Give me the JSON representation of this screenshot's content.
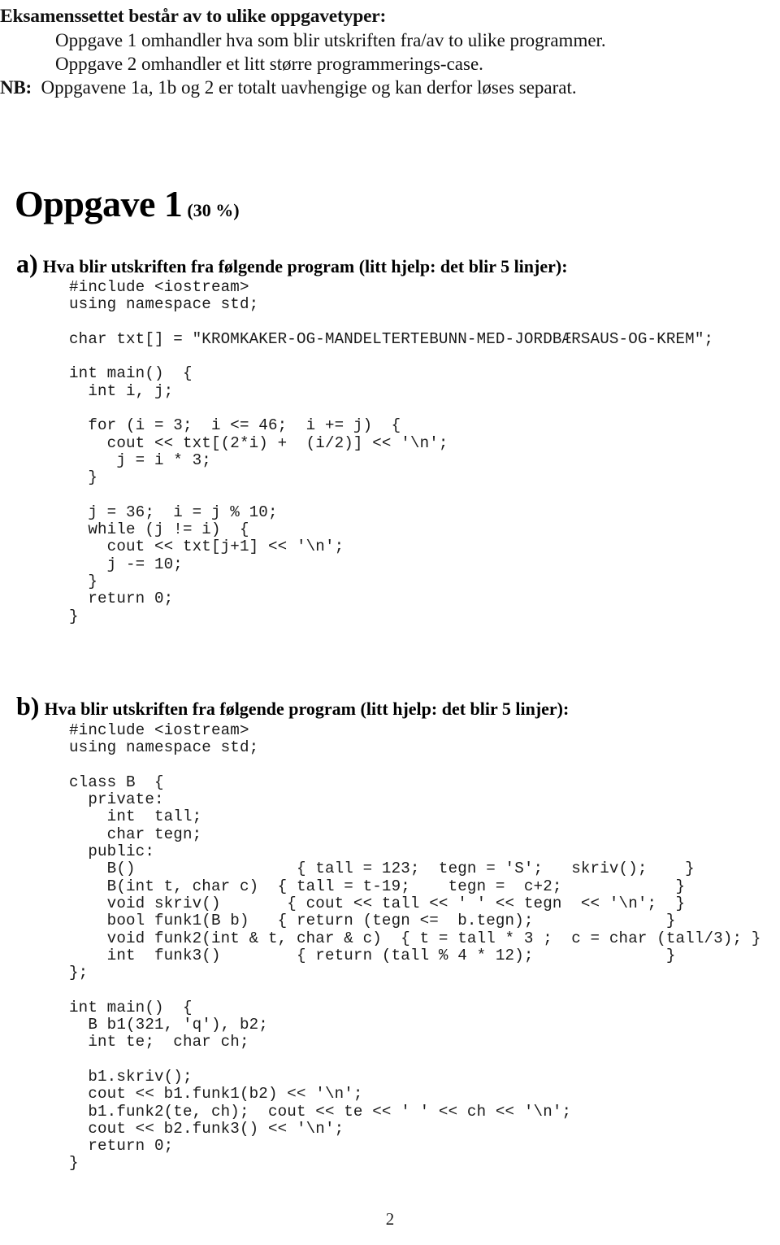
{
  "intro": {
    "heading": "Eksamenssettet består av to ulike oppgavetyper:",
    "line1": "Oppgave 1 omhandler hva som blir utskriften fra/av to ulike programmer.",
    "line2": "Oppgave 2 omhandler et litt større programmerings-case.",
    "nb_label": "NB:",
    "nb_text": "  Oppgavene 1a, 1b og 2 er totalt uavhengige og kan derfor løses separat."
  },
  "oppgave": {
    "title": "Oppgave 1",
    "weight": "(30 %)"
  },
  "questions": {
    "a": {
      "letter": "a)",
      "text": "Hva blir utskriften fra følgende program (litt hjelp: det blir 5 linjer):",
      "code": "#include <iostream>\nusing namespace std;\n\nchar txt[] = \"KROMKAKER-OG-MANDELTERTEBUNN-MED-JORDBÆRSAUS-OG-KREM\";\n\nint main()  {\n  int i, j;\n\n  for (i = 3;  i <= 46;  i += j)  {\n    cout << txt[(2*i) +  (i/2)] << '\\n';\n     j = i * 3;\n  }\n\n  j = 36;  i = j % 10;\n  while (j != i)  {\n    cout << txt[j+1] << '\\n';\n    j -= 10;\n  }\n  return 0;\n}"
    },
    "b": {
      "letter": "b)",
      "text": "Hva blir utskriften fra følgende program (litt hjelp: det blir 5 linjer):",
      "code": "#include <iostream>\nusing namespace std;\n\nclass B  {\n  private:\n    int  tall;\n    char tegn;\n  public:\n    B()                 { tall = 123;  tegn = 'S';   skriv();    }\n    B(int t, char c)  { tall = t-19;    tegn =  c+2;            }\n    void skriv()       { cout << tall << ' ' << tegn  << '\\n';  }\n    bool funk1(B b)   { return (tegn <=  b.tegn);              }\n    void funk2(int & t, char & c)  { t = tall * 3 ;  c = char (tall/3); }\n    int  funk3()        { return (tall % 4 * 12);              }\n};\n\nint main()  {\n  B b1(321, 'q'), b2;\n  int te;  char ch;\n\n  b1.skriv();\n  cout << b1.funk1(b2) << '\\n';\n  b1.funk2(te, ch);  cout << te << ' ' << ch << '\\n';\n  cout << b2.funk3() << '\\n';\n  return 0;\n}"
    }
  },
  "footer": {
    "page_number": "2"
  }
}
